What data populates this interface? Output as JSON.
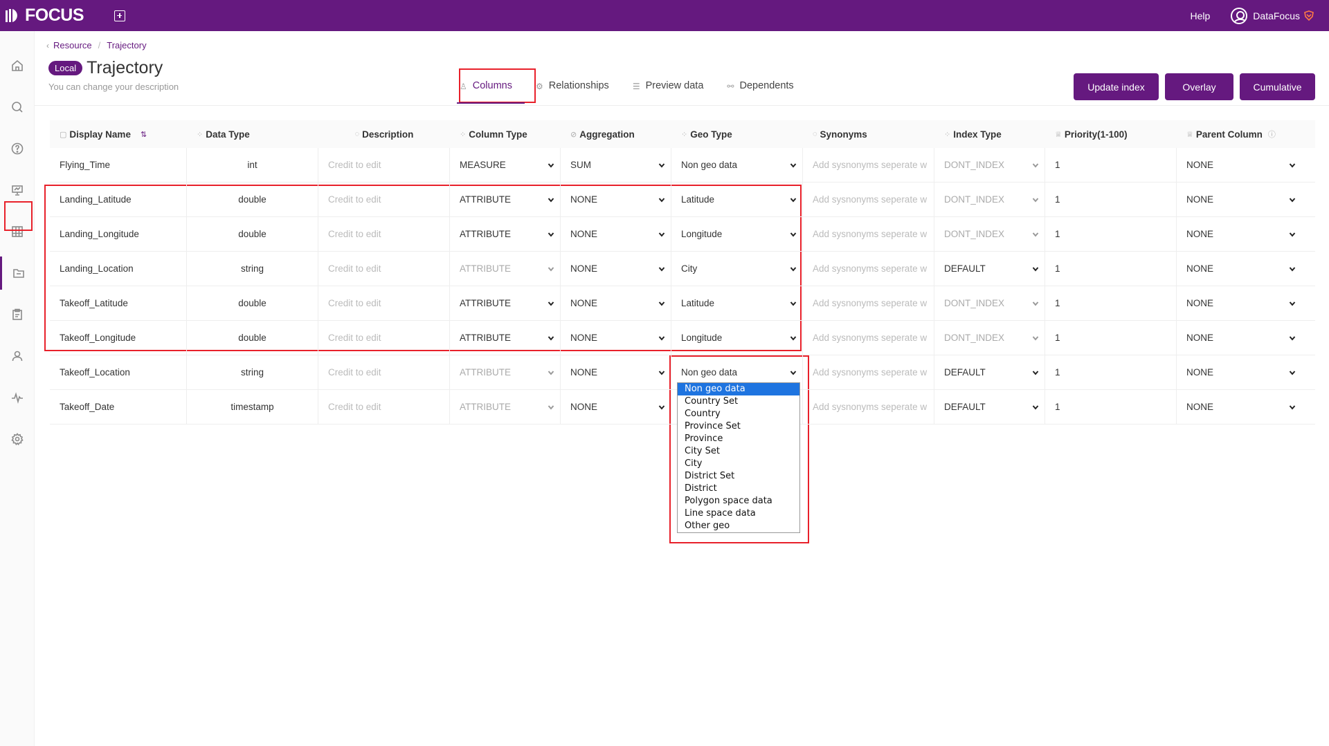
{
  "app": {
    "logo_text": "FOCUS",
    "help_label": "Help",
    "user_name": "DataFocus"
  },
  "breadcrumb": {
    "root": "Resource",
    "current": "Trajectory"
  },
  "page": {
    "badge": "Local",
    "title": "Trajectory",
    "description": "You can change your description"
  },
  "tabs": [
    {
      "label": "Columns",
      "icon": "user-icon",
      "active": true
    },
    {
      "label": "Relationships",
      "icon": "gear-icon",
      "active": false
    },
    {
      "label": "Preview data",
      "icon": "database-icon",
      "active": false
    },
    {
      "label": "Dependents",
      "icon": "link-icon",
      "active": false
    }
  ],
  "actions": {
    "update_index": "Update index",
    "overlay": "Overlay",
    "cumulative": "Cumulative"
  },
  "columns": {
    "display_name": "Display Name",
    "data_type": "Data Type",
    "description": "Description",
    "column_type": "Column Type",
    "aggregation": "Aggregation",
    "geo_type": "Geo Type",
    "synonyms": "Synonyms",
    "index_type": "Index Type",
    "priority": "Priority(1-100)",
    "parent_column": "Parent Column"
  },
  "placeholders": {
    "description": "Credit to edit",
    "synonyms": "Add sysnonyms seperate w"
  },
  "rows": [
    {
      "name": "Flying_Time",
      "data_type": "int",
      "column_type": "MEASURE",
      "column_type_disabled": false,
      "aggregation": "SUM",
      "geo_type": "Non geo data",
      "index_type": "DONT_INDEX",
      "index_muted": true,
      "priority": "1",
      "parent": "NONE"
    },
    {
      "name": "Landing_Latitude",
      "data_type": "double",
      "column_type": "ATTRIBUTE",
      "column_type_disabled": false,
      "aggregation": "NONE",
      "geo_type": "Latitude",
      "index_type": "DONT_INDEX",
      "index_muted": true,
      "priority": "1",
      "parent": "NONE"
    },
    {
      "name": "Landing_Longitude",
      "data_type": "double",
      "column_type": "ATTRIBUTE",
      "column_type_disabled": false,
      "aggregation": "NONE",
      "geo_type": "Longitude",
      "index_type": "DONT_INDEX",
      "index_muted": true,
      "priority": "1",
      "parent": "NONE"
    },
    {
      "name": "Landing_Location",
      "data_type": "string",
      "column_type": "ATTRIBUTE",
      "column_type_disabled": true,
      "aggregation": "NONE",
      "geo_type": "City",
      "index_type": "DEFAULT",
      "index_muted": false,
      "priority": "1",
      "parent": "NONE"
    },
    {
      "name": "Takeoff_Latitude",
      "data_type": "double",
      "column_type": "ATTRIBUTE",
      "column_type_disabled": false,
      "aggregation": "NONE",
      "geo_type": "Latitude",
      "index_type": "DONT_INDEX",
      "index_muted": true,
      "priority": "1",
      "parent": "NONE"
    },
    {
      "name": "Takeoff_Longitude",
      "data_type": "double",
      "column_type": "ATTRIBUTE",
      "column_type_disabled": false,
      "aggregation": "NONE",
      "geo_type": "Longitude",
      "index_type": "DONT_INDEX",
      "index_muted": true,
      "priority": "1",
      "parent": "NONE"
    },
    {
      "name": "Takeoff_Location",
      "data_type": "string",
      "column_type": "ATTRIBUTE",
      "column_type_disabled": true,
      "aggregation": "NONE",
      "geo_type": "Non geo data",
      "index_type": "DEFAULT",
      "index_muted": false,
      "priority": "1",
      "parent": "NONE"
    },
    {
      "name": "Takeoff_Date",
      "data_type": "timestamp",
      "column_type": "ATTRIBUTE",
      "column_type_disabled": true,
      "aggregation": "NONE",
      "geo_type": "",
      "index_type": "DEFAULT",
      "index_muted": false,
      "priority": "1",
      "parent": "NONE"
    }
  ],
  "geo_dropdown": {
    "selected": "Non geo data",
    "options": [
      "Non geo data",
      "Country Set",
      "Country",
      "Province Set",
      "Province",
      "City Set",
      "City",
      "District Set",
      "District",
      "Polygon space data",
      "Line space data",
      "Other geo"
    ]
  },
  "colors": {
    "brand": "#65197f",
    "highlight": "#e8202a",
    "selection": "#1e74e0"
  }
}
